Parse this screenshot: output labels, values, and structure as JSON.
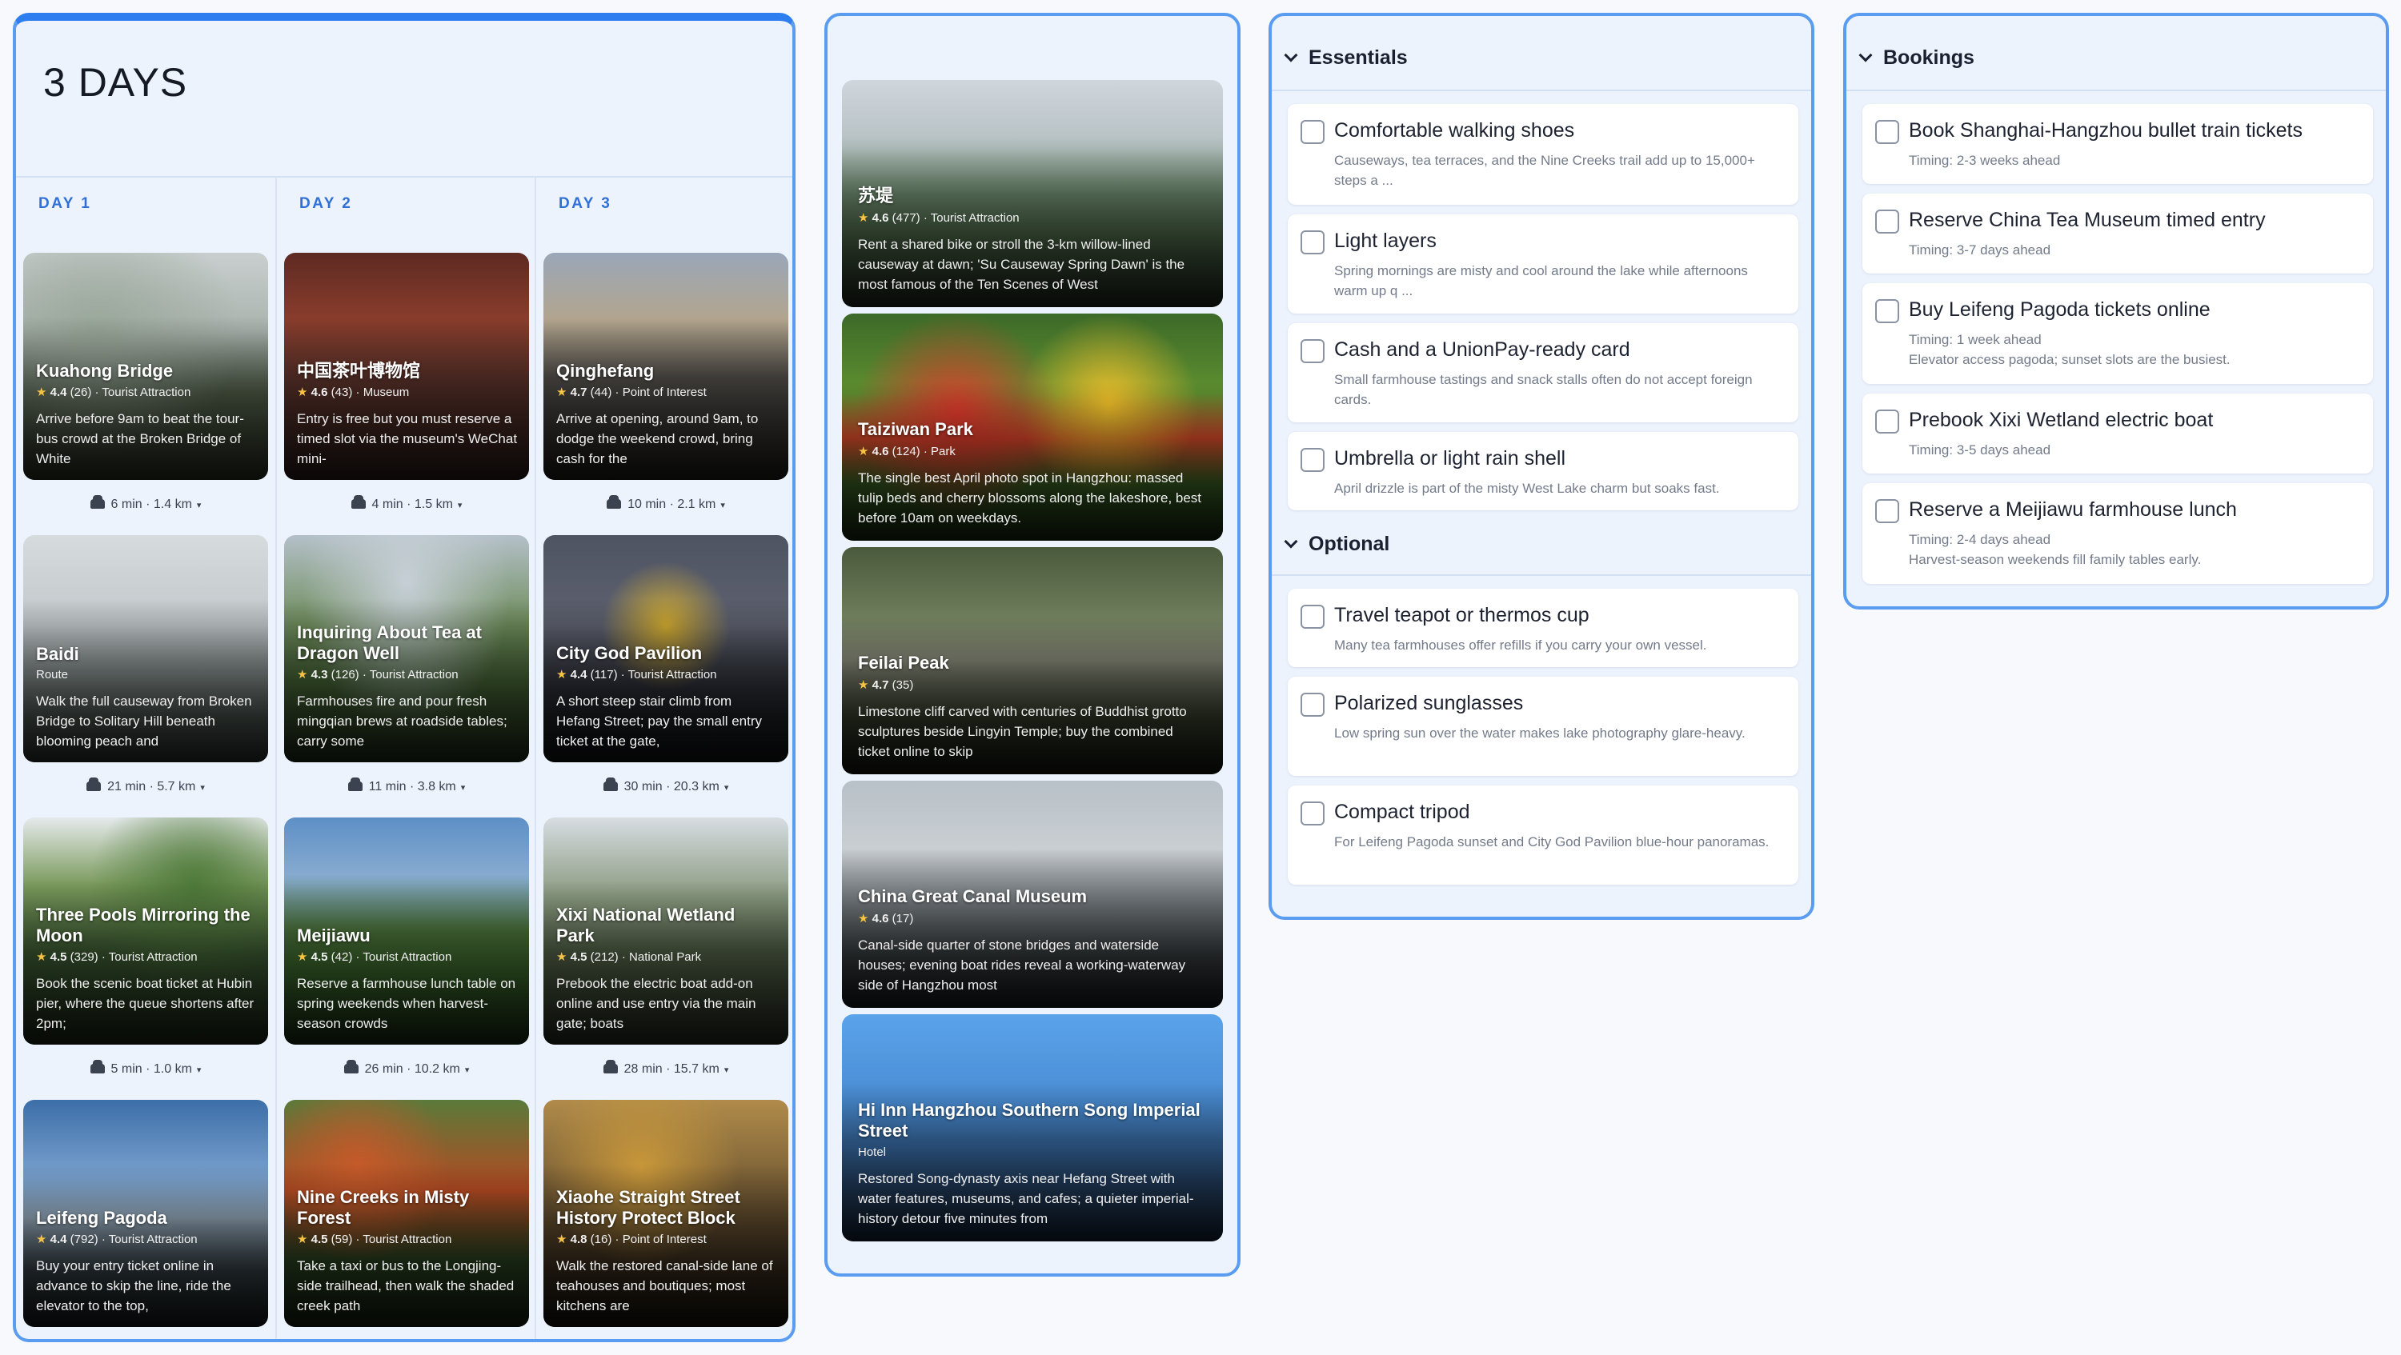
{
  "trip": {
    "title": "3 DAYS"
  },
  "days": [
    {
      "label": "DAY 1",
      "places": [
        {
          "name": "Kuahong Bridge",
          "rating": "4.4",
          "reviews": "(26)",
          "category": "Tourist Attraction",
          "description": "Arrive before 9am to beat the tour-bus crowd at the Broken Bridge of White"
        },
        {
          "name": "Baidi",
          "rating": "",
          "reviews": "",
          "category": "Route",
          "description": "Walk the full causeway from Broken Bridge to Solitary Hill beneath blooming peach and"
        },
        {
          "name": "Three Pools Mirroring the Moon",
          "rating": "4.5",
          "reviews": "(329)",
          "category": "Tourist Attraction",
          "description": "Book the scenic boat ticket at Hubin pier, where the queue shortens after 2pm;"
        },
        {
          "name": "Leifeng Pagoda",
          "rating": "4.4",
          "reviews": "(792)",
          "category": "Tourist Attraction",
          "description": "Buy your entry ticket online in advance to skip the line, ride the elevator to the top,"
        }
      ],
      "travel": [
        "6 min · 1.4 km",
        "21 min · 5.7 km",
        "5 min · 1.0 km"
      ]
    },
    {
      "label": "DAY 2",
      "places": [
        {
          "name": "中国茶叶博物馆",
          "rating": "4.6",
          "reviews": "(43)",
          "category": "Museum",
          "description": "Entry is free but you must reserve a timed slot via the museum's WeChat mini-"
        },
        {
          "name": "Inquiring About Tea at Dragon Well",
          "rating": "4.3",
          "reviews": "(126)",
          "category": "Tourist Attraction",
          "description": "Farmhouses fire and pour fresh mingqian brews at roadside tables; carry some"
        },
        {
          "name": "Meijiawu",
          "rating": "4.5",
          "reviews": "(42)",
          "category": "Tourist Attraction",
          "description": "Reserve a farmhouse lunch table on spring weekends when harvest-season crowds"
        },
        {
          "name": "Nine Creeks in Misty Forest",
          "rating": "4.5",
          "reviews": "(59)",
          "category": "Tourist Attraction",
          "description": "Take a taxi or bus to the Longjing-side trailhead, then walk the shaded creek path"
        }
      ],
      "travel": [
        "4 min · 1.5 km",
        "11 min · 3.8 km",
        "26 min · 10.2 km"
      ]
    },
    {
      "label": "DAY 3",
      "places": [
        {
          "name": "Qinghefang",
          "rating": "4.7",
          "reviews": "(44)",
          "category": "Point of Interest",
          "description": "Arrive at opening, around 9am, to dodge the weekend crowd, bring cash for the"
        },
        {
          "name": "City God Pavilion",
          "rating": "4.4",
          "reviews": "(117)",
          "category": "Tourist Attraction",
          "description": "A short steep stair climb from Hefang Street; pay the small entry ticket at the gate,"
        },
        {
          "name": "Xixi National Wetland Park",
          "rating": "4.5",
          "reviews": "(212)",
          "category": "National Park",
          "description": "Prebook the electric boat add-on online and use entry via the main gate; boats"
        },
        {
          "name": "Xiaohe Straight Street History Protect Block",
          "rating": "4.8",
          "reviews": "(16)",
          "category": "Point of Interest",
          "description": "Walk the restored canal-side lane of teahouses and boutiques; most kitchens are"
        }
      ],
      "travel": [
        "10 min · 2.1 km",
        "30 min · 20.3 km",
        "28 min · 15.7 km"
      ]
    }
  ],
  "saved": [
    {
      "name": "苏堤",
      "rating": "4.6",
      "reviews": "(477)",
      "category": "Tourist Attraction",
      "description": "Rent a shared bike or stroll the 3-km willow-lined causeway at dawn; 'Su Causeway Spring Dawn' is the most famous of the Ten Scenes of West"
    },
    {
      "name": "Taiziwan Park",
      "rating": "4.6",
      "reviews": "(124)",
      "category": "Park",
      "description": "The single best April photo spot in Hangzhou: massed tulip beds and cherry blossoms along the lakeshore, best before 10am on weekdays."
    },
    {
      "name": "Feilai Peak",
      "rating": "4.7",
      "reviews": "(35)",
      "category": "",
      "description": "Limestone cliff carved with centuries of Buddhist grotto sculptures beside Lingyin Temple; buy the combined ticket online to skip"
    },
    {
      "name": "China Great Canal Museum",
      "rating": "4.6",
      "reviews": "(17)",
      "category": "",
      "description": "Canal-side quarter of stone bridges and waterside houses; evening boat rides reveal a working-waterway side of Hangzhou most"
    },
    {
      "name": "Hi Inn Hangzhou Southern Song Imperial Street",
      "rating": "",
      "reviews": "",
      "category": "Hotel",
      "description": "Restored Song-dynasty axis near Hefang Street with water features, museums, and cafes; a quieter imperial-history detour five minutes from"
    }
  ],
  "packing": {
    "essentials_title": "Essentials",
    "optional_title": "Optional",
    "essentials": [
      {
        "title": "Comfortable walking shoes",
        "note": "Causeways, tea terraces, and the Nine Creeks trail add up to 15,000+ steps a ..."
      },
      {
        "title": "Light layers",
        "note": "Spring mornings are misty and cool around the lake while afternoons warm up q ..."
      },
      {
        "title": "Cash and a UnionPay-ready card",
        "note": "Small farmhouse tastings and snack stalls often do not accept foreign cards."
      },
      {
        "title": "Umbrella or light rain shell",
        "note": "April drizzle is part of the misty West Lake charm but soaks fast."
      }
    ],
    "optional": [
      {
        "title": "Travel teapot or thermos cup",
        "note": "Many tea farmhouses offer refills if you carry your own vessel."
      },
      {
        "title": "Polarized sunglasses",
        "note": "Low spring sun over the water makes lake photography glare-heavy."
      },
      {
        "title": "Compact tripod",
        "note": "For Leifeng Pagoda sunset and City God Pavilion blue-hour panoramas."
      }
    ]
  },
  "bookings": {
    "title": "Bookings",
    "items": [
      {
        "title": "Book Shanghai-Hangzhou bullet train tickets",
        "timing": "Timing: 2-3 weeks ahead",
        "note": ""
      },
      {
        "title": "Reserve China Tea Museum timed entry",
        "timing": "Timing: 3-7 days ahead",
        "note": ""
      },
      {
        "title": "Buy Leifeng Pagoda tickets online",
        "timing": "Timing: 1 week ahead",
        "note": "Elevator access pagoda; sunset slots are the busiest."
      },
      {
        "title": "Prebook Xixi Wetland electric boat",
        "timing": "Timing: 3-5 days ahead",
        "note": ""
      },
      {
        "title": "Reserve a Meijiawu farmhouse lunch",
        "timing": "Timing: 2-4 days ahead",
        "note": "Harvest-season weekends fill family tables early."
      }
    ]
  },
  "colors": {
    "accent": "#2f7ef0",
    "panel_border": "#5a9cf0",
    "panel_bg": "#edf3fd",
    "star": "#f6c343"
  }
}
